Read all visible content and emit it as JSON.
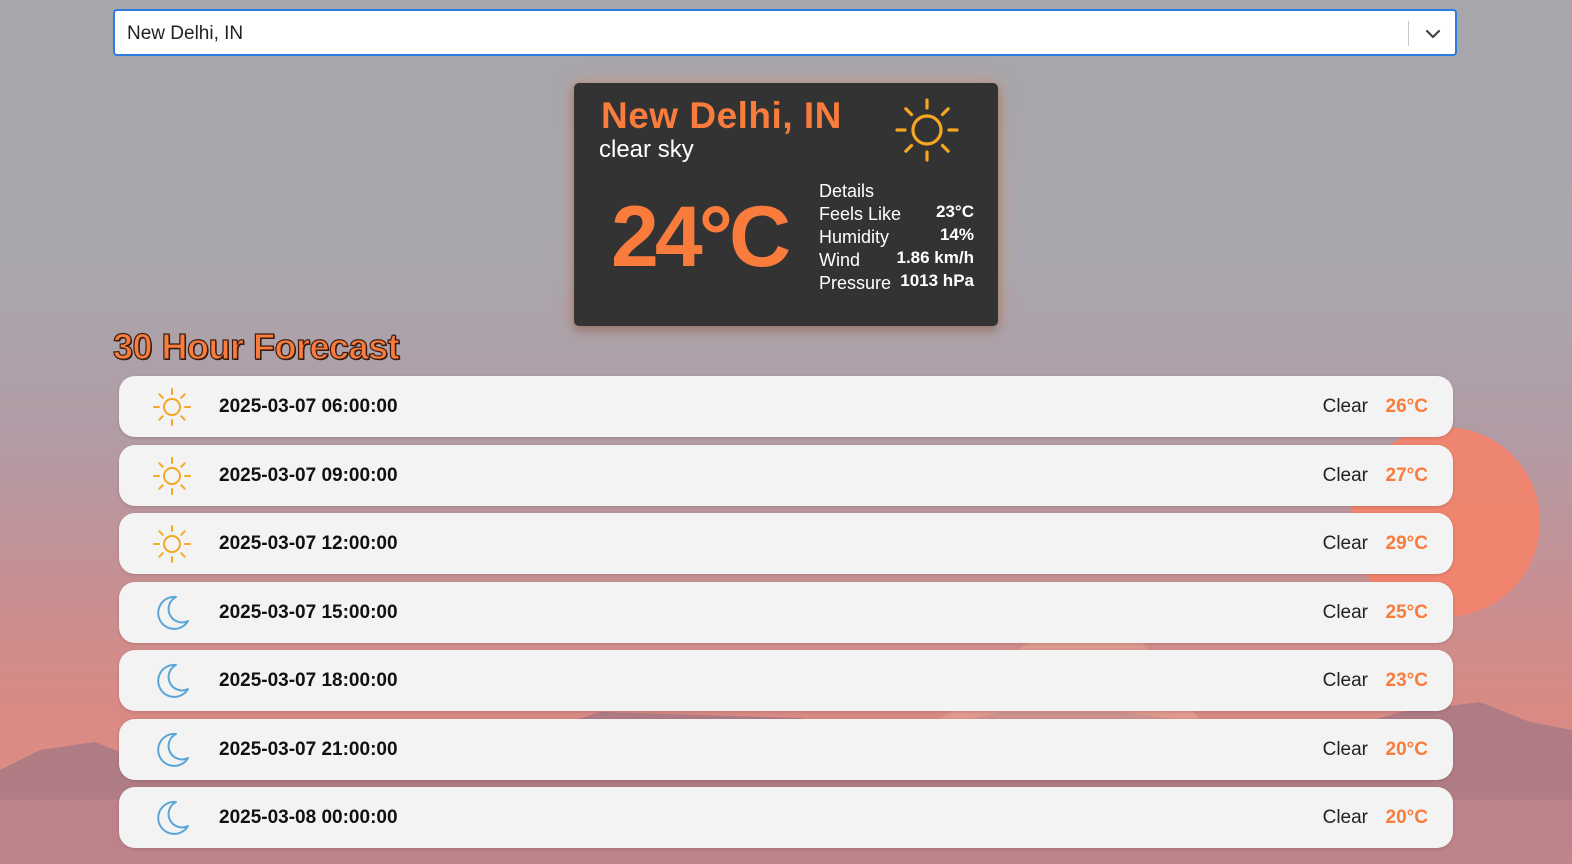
{
  "search": {
    "selected_value": "New Delhi, IN"
  },
  "current": {
    "city": "New Delhi, IN",
    "description": "clear sky",
    "icon": "sun-icon",
    "temperature": "24°C",
    "details": {
      "heading": "Details",
      "rows": [
        {
          "label": "Feels Like",
          "value": "23°C"
        },
        {
          "label": "Humidity",
          "value": "14%"
        },
        {
          "label": "Wind",
          "value": "1.86 km/h"
        },
        {
          "label": "Pressure",
          "value": "1013 hPa"
        }
      ]
    }
  },
  "forecast": {
    "title": "30 Hour Forecast",
    "items": [
      {
        "icon": "sun-icon",
        "time": "2025-03-07 06:00:00",
        "condition": "Clear",
        "temp": "26°C"
      },
      {
        "icon": "sun-icon",
        "time": "2025-03-07 09:00:00",
        "condition": "Clear",
        "temp": "27°C"
      },
      {
        "icon": "sun-icon",
        "time": "2025-03-07 12:00:00",
        "condition": "Clear",
        "temp": "29°C"
      },
      {
        "icon": "moon-icon",
        "time": "2025-03-07 15:00:00",
        "condition": "Clear",
        "temp": "25°C"
      },
      {
        "icon": "moon-icon",
        "time": "2025-03-07 18:00:00",
        "condition": "Clear",
        "temp": "23°C"
      },
      {
        "icon": "moon-icon",
        "time": "2025-03-07 21:00:00",
        "condition": "Clear",
        "temp": "20°C"
      },
      {
        "icon": "moon-icon",
        "time": "2025-03-08 00:00:00",
        "condition": "Clear",
        "temp": "20°C"
      }
    ]
  },
  "colors": {
    "accent": "#f97c3c",
    "card_bg": "#333333",
    "row_bg": "#f3f3f3",
    "sun_icon": "#f5a623",
    "moon_icon": "#5aa7d6",
    "select_border": "#2d7be5"
  }
}
